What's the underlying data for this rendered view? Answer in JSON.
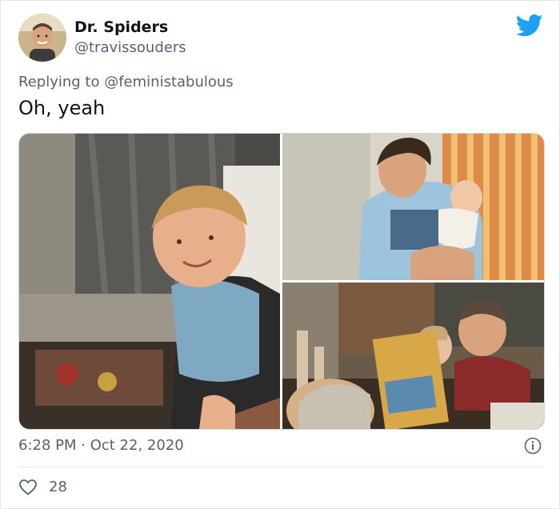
{
  "tweet": {
    "author_name": "Dr. Spiders",
    "author_handle": "@travissouders",
    "replying_prefix": "Replying to",
    "replying_to": "@feministabulous",
    "text": "Oh, yeah",
    "timestamp": "6:28 PM · Oct 22, 2020",
    "like_count": "28"
  },
  "icons": {
    "brand": "twitter-bird-icon",
    "info": "info-icon",
    "like": "heart-icon"
  },
  "colors": {
    "brand_blue": "#1da1f2",
    "muted_text": "#536471",
    "primary_text": "#0f1419",
    "border": "#e1e8ed"
  },
  "media": {
    "photos": [
      {
        "description": "photo-toddler"
      },
      {
        "description": "photo-man-holding-baby"
      },
      {
        "description": "photo-kids-with-box"
      }
    ]
  }
}
